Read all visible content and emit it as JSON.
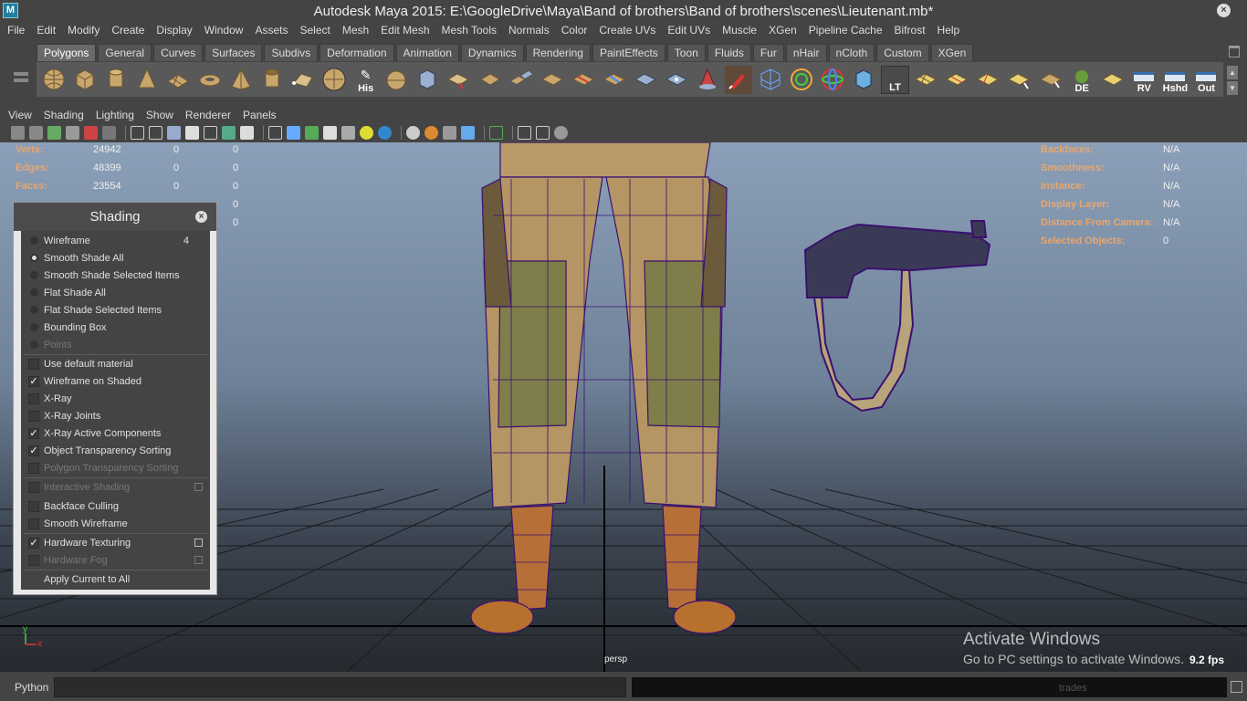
{
  "window": {
    "title": "Autodesk Maya 2015: E:\\GoogleDrive\\Maya\\Band of brothers\\Band of brothers\\scenes\\Lieutenant.mb*",
    "app_icon": "M"
  },
  "menubar": [
    "File",
    "Edit",
    "Modify",
    "Create",
    "Display",
    "Window",
    "Assets",
    "Select",
    "Mesh",
    "Edit Mesh",
    "Mesh Tools",
    "Normals",
    "Color",
    "Create UVs",
    "Edit UVs",
    "Muscle",
    "XGen",
    "Pipeline Cache",
    "Bifrost",
    "Help"
  ],
  "shelf": {
    "tabs": [
      "Polygons",
      "General",
      "Curves",
      "Surfaces",
      "Subdivs",
      "Deformation",
      "Animation",
      "Dynamics",
      "Rendering",
      "PaintEffects",
      "Toon",
      "Fluids",
      "Fur",
      "nHair",
      "nCloth",
      "Custom",
      "XGen"
    ],
    "active_tab": "Polygons",
    "text_icons": {
      "his": "His",
      "lt": "LT",
      "de": "DE",
      "rv": "RV",
      "hshd": "Hshd",
      "out": "Out"
    }
  },
  "panel_menu": [
    "View",
    "Shading",
    "Lighting",
    "Show",
    "Renderer",
    "Panels"
  ],
  "hud_left": [
    {
      "label": "Verts:",
      "v1": "24942",
      "v2": "0",
      "v3": "0"
    },
    {
      "label": "Edges:",
      "v1": "48399",
      "v2": "0",
      "v3": "0"
    },
    {
      "label": "Faces:",
      "v1": "23554",
      "v2": "0",
      "v3": "0"
    }
  ],
  "hud_left_extra": [
    "0",
    "0"
  ],
  "hud_right": [
    {
      "label": "Backfaces:",
      "value": "N/A"
    },
    {
      "label": "Smoothness:",
      "value": "N/A"
    },
    {
      "label": "Instance:",
      "value": "N/A"
    },
    {
      "label": "Display Layer:",
      "value": "N/A"
    },
    {
      "label": "Distance From Camera:",
      "value": "N/A"
    },
    {
      "label": "Selected Objects:",
      "value": "0"
    }
  ],
  "shading_panel": {
    "title": "Shading",
    "wireframe": {
      "label": "Wireframe",
      "hotkey": "4"
    },
    "smooth_all": "Smooth Shade All",
    "smooth_selected": "Smooth Shade Selected Items",
    "flat_all": "Flat Shade All",
    "flat_selected": "Flat Shade Selected Items",
    "bounding_box": "Bounding Box",
    "points": "Points",
    "use_default_material": "Use default material",
    "wireframe_on_shaded": "Wireframe on Shaded",
    "xray": "X-Ray",
    "xray_joints": "X-Ray Joints",
    "xray_active": "X-Ray Active Components",
    "object_transparency": "Object Transparency Sorting",
    "polygon_transparency": "Polygon Transparency Sorting",
    "interactive_shading": "Interactive Shading",
    "backface_culling": "Backface Culling",
    "smooth_wireframe": "Smooth Wireframe",
    "hardware_texturing": "Hardware Texturing",
    "hardware_fog": "Hardware Fog",
    "apply_all": "Apply Current to All",
    "check_mark": "✓"
  },
  "viewport": {
    "camera": "persp",
    "fps": "9.2 fps",
    "axis_y": "y",
    "axis_x": "x"
  },
  "activation": {
    "line1": "Activate Windows",
    "line2": "Go to PC settings to activate Windows."
  },
  "status": {
    "trades": "trades"
  },
  "command_line": {
    "label": "Python"
  },
  "colors": {
    "hud_label": "#e8a76f",
    "wire": "#4a1a8a",
    "pants": "#b89a6a"
  }
}
